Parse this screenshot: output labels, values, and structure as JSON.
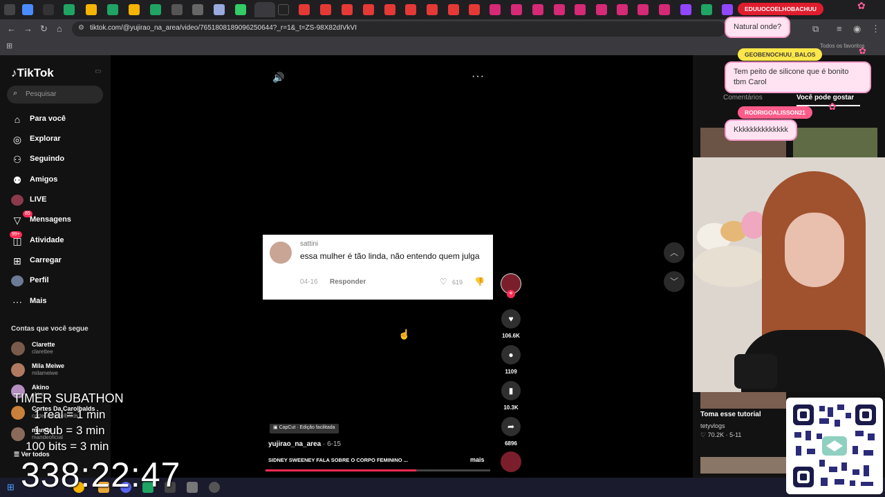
{
  "browser": {
    "url": "tiktok.com/@yujirao_na_area/video/7651808189096250644?_r=1&_t=ZS-98X82dIVkVI",
    "bookmarks_label": "Todos os favoritos"
  },
  "tiktok": {
    "logo": "TikTok",
    "search_placeholder": "Pesquisar",
    "nav": [
      {
        "label": "Para você",
        "icon": "home-icon"
      },
      {
        "label": "Explorar",
        "icon": "compass-icon"
      },
      {
        "label": "Seguindo",
        "icon": "following-icon"
      },
      {
        "label": "Amigos",
        "icon": "friends-icon"
      },
      {
        "label": "LIVE",
        "icon": "live-icon"
      },
      {
        "label": "Mensagens",
        "icon": "messages-icon",
        "badge": "85"
      },
      {
        "label": "Atividade",
        "icon": "activity-icon",
        "badge": "99+"
      },
      {
        "label": "Carregar",
        "icon": "upload-icon"
      },
      {
        "label": "Perfil",
        "icon": "profile-avatar"
      },
      {
        "label": "Mais",
        "icon": "more-icon"
      }
    ],
    "following_title": "Contas que você segue",
    "following": [
      {
        "name": "Clarette",
        "handle": "clarettee"
      },
      {
        "name": "Mila Meiwe",
        "handle": "milameiwe"
      },
      {
        "name": "Akino",
        "handle": "akino"
      },
      {
        "name": "Cortes Da Carolbalds",
        "handle": "cortesdacarolbalds"
      },
      {
        "name": "mande",
        "handle": "mandeoficial"
      }
    ],
    "see_all": "Ver todos"
  },
  "video": {
    "comment": {
      "user": "sattini",
      "text": "essa mulher é tão linda, não entendo quem julga",
      "date": "04-16",
      "reply": "Responder",
      "likes": "619"
    },
    "capcut_label": "CapCut · Edição facilitada",
    "author": "yujirao_na_area",
    "date": "6-15",
    "description": "SIDNEY SWEENEY FALA SOBRE O CORPO FEMININO ...",
    "more": "mais",
    "progress": 0.67,
    "actions": {
      "likes": "106.6K",
      "comments": "1109",
      "saves": "10.3K",
      "shares": "6896"
    }
  },
  "right_panel": {
    "tab_comments": "Comentários",
    "tab_recommended": "Você pode gostar",
    "rec_title": "Toma esse tutorial",
    "rec_author": "tetyvlogs",
    "rec_likes": "♡ 70.2K",
    "rec_date": "5-11"
  },
  "chat": [
    {
      "user": "EDUUOCOELHOBACHUU",
      "message": "Natural onde?",
      "color": "#ff1744"
    },
    {
      "user": "GEOBENOCHUU_BALOS",
      "message": "Tem peito de silicone que é bonito tbm Carol",
      "color": "#ffee58"
    },
    {
      "user": "RODRIGOALISSON21",
      "message": "Kkkkkkkkkkkkkk",
      "color": "#ff5c8a"
    }
  ],
  "stream_overlay": {
    "title": "TIMER SUBATHON",
    "rules": [
      "1 real = 1 min",
      "1 sub = 3 min",
      "100 bits = 3 min"
    ],
    "timer": "338:22:47"
  }
}
